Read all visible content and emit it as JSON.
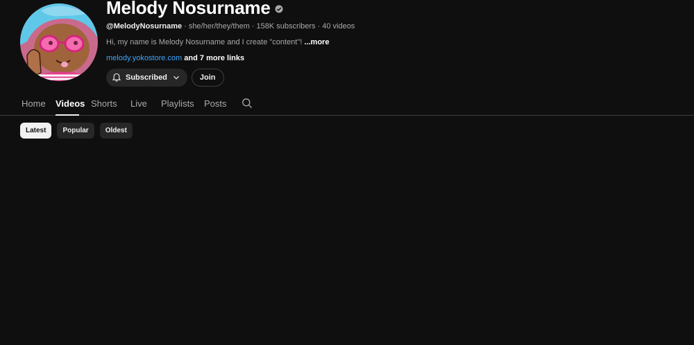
{
  "channel": {
    "name": "Melody Nosurname",
    "handle": "@MelodyNosurname",
    "pronouns": "she/her/they/them",
    "subscribers": "158K subscribers",
    "videos": "40 videos",
    "description": "Hi, my name is Melody Nosurname and I create \"content\"!",
    "more_label": "...more",
    "link": "melody.yokostore.com",
    "more_links": "and 7 more links",
    "verified_icon": "verified-check-icon"
  },
  "buttons": {
    "subscribed_label": "Subscribed",
    "join_label": "Join"
  },
  "tabs": [
    {
      "label": "Home",
      "active": false
    },
    {
      "label": "Videos",
      "active": true
    },
    {
      "label": "Shorts",
      "active": false
    },
    {
      "label": "Live",
      "active": false
    },
    {
      "label": "Playlists",
      "active": false
    },
    {
      "label": "Posts",
      "active": false
    }
  ],
  "chips": [
    {
      "label": "Latest",
      "active": true
    },
    {
      "label": "Popular",
      "active": false
    },
    {
      "label": "Oldest",
      "active": false
    }
  ],
  "colors": {
    "background": "#0f0f0f",
    "link": "#3ea6ff",
    "chip_active_bg": "#f1f1f1",
    "chip_bg": "#272727"
  }
}
